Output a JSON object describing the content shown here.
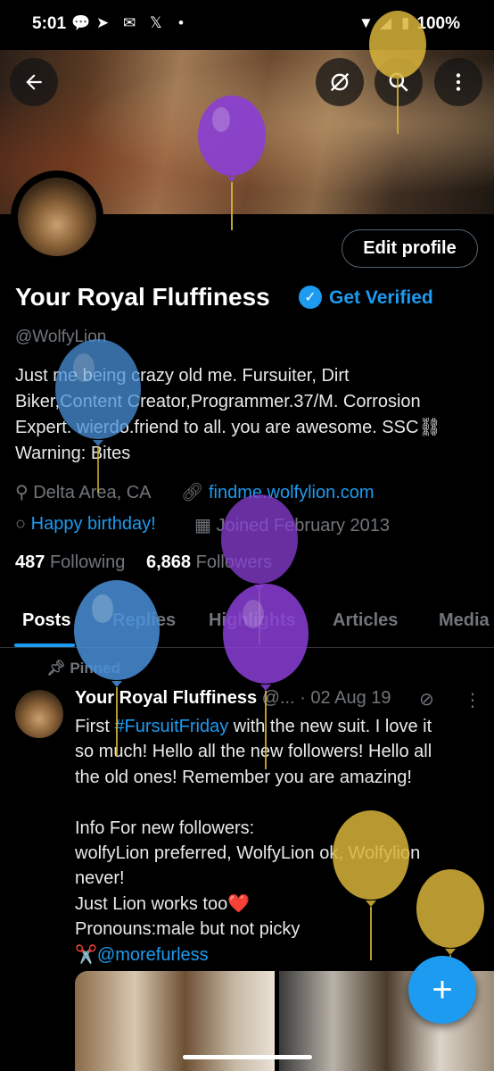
{
  "status_bar": {
    "time": "5:01",
    "battery": "100%"
  },
  "header": {
    "back_icon": "back-arrow-icon",
    "icons": [
      "refresh-off-icon",
      "search-icon",
      "more-vertical-icon"
    ]
  },
  "profile": {
    "name": "Your Royal Fluffiness",
    "get_verified": "Get Verified",
    "handle": "@WolfyLion",
    "edit_profile": "Edit profile",
    "bio_lines": [
      "Just me being crazy old me. Fursuiter, Dirt",
      "Biker,Content Creator,Programmer.37/M. Corrosion",
      "Expert. wierdo.friend to all. you are awesome. SSC⛓",
      "Warning: Bites"
    ],
    "location": "Delta Area, CA",
    "website": "findme.wolfylion.com",
    "birthday": "Happy birthday!",
    "joined": "Joined February 2013",
    "following_count": "487",
    "following_label": "Following",
    "followers_count": "6,868",
    "followers_label": "Followers"
  },
  "tabs": [
    "Posts",
    "Replies",
    "Highlights",
    "Articles",
    "Media"
  ],
  "pinned_post": {
    "pinned_label": "Pinned",
    "author": "Your Royal Fluffiness",
    "handle_trunc": "@...",
    "date": "· 02 Aug 19",
    "text_line1_prefix": "First ",
    "hashtag": "#FursuitFriday",
    "text_line1_suffix": " with the new suit. I love it",
    "text_body": "so much! Hello all the new followers! Hello all\nthe old ones! Remember you are amazing!\n\nInfo For new followers:\nwolfyLion preferred, WolfyLion ok, Wolfylion\nnever!\nJust Lion works too❤️\nPronouns:male but not picky",
    "scissors": "✂️",
    "mention": "@morefurless"
  },
  "colors": {
    "accent": "#1d9bf0",
    "balloon_purple": "#8a3fd6",
    "balloon_blue": "#4a90d9",
    "balloon_gold": "#d9b43a"
  }
}
